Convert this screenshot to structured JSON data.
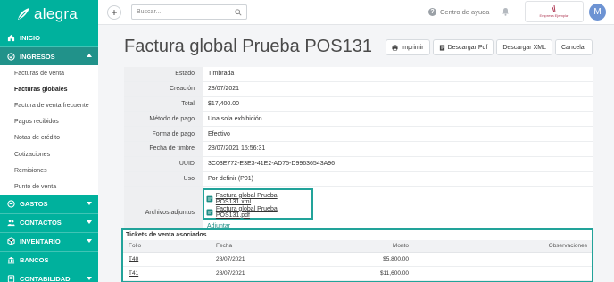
{
  "brand": {
    "name": "alegra",
    "accent": "#00b19d",
    "highlight": "#22a39a"
  },
  "sidebar": {
    "inicio": "INICIO",
    "ingresos": "INGRESOS",
    "ingresos_items": [
      "Facturas de venta",
      "Facturas globales",
      "Factura de venta frecuente",
      "Pagos recibidos",
      "Notas de crédito",
      "Cotizaciones",
      "Remisiones",
      "Punto de venta"
    ],
    "selected_item": "Facturas globales",
    "sections": [
      "GASTOS",
      "CONTACTOS",
      "INVENTARIO",
      "BANCOS",
      "CONTABILIDAD"
    ]
  },
  "topbar": {
    "search_placeholder": "Buscar...",
    "help_label": "Centro de ayuda",
    "company_name": "Empresa Ejemplar",
    "avatar_initial": "M"
  },
  "page": {
    "title": "Factura global Prueba POS131",
    "buttons": {
      "print": "Imprimir",
      "pdf": "Descargar Pdf",
      "xml": "Descargar XML",
      "cancel": "Cancelar"
    }
  },
  "details": [
    {
      "label": "Estado",
      "value": "Timbrada"
    },
    {
      "label": "Creación",
      "value": "28/07/2021"
    },
    {
      "label": "Total",
      "value": "$17,400.00"
    },
    {
      "label": "Método de pago",
      "value": "Una sola exhibición"
    },
    {
      "label": "Forma de pago",
      "value": "Efectivo"
    },
    {
      "label": "Fecha de timbre",
      "value": "28/07/2021 15:56:31"
    },
    {
      "label": "UUID",
      "value": "3C03E772-E3E3-41E2-AD75-D99636543A96"
    },
    {
      "label": "Uso",
      "value": "Por definir (P01)"
    }
  ],
  "attachments": {
    "label": "Archivos adjuntos",
    "files": [
      "Factura global Prueba POS131.xml",
      "Factura global Prueba POS131.pdf"
    ],
    "add_link": "Adjuntar"
  },
  "tickets": {
    "title": "Tickets de venta asociados",
    "columns": [
      "Folio",
      "Fecha",
      "Monto",
      "Observaciones"
    ],
    "rows": [
      {
        "folio": "T40",
        "fecha": "28/07/2021",
        "monto": "$5,800.00",
        "obs": ""
      },
      {
        "folio": "T41",
        "fecha": "28/07/2021",
        "monto": "$11,600.00",
        "obs": ""
      }
    ]
  }
}
